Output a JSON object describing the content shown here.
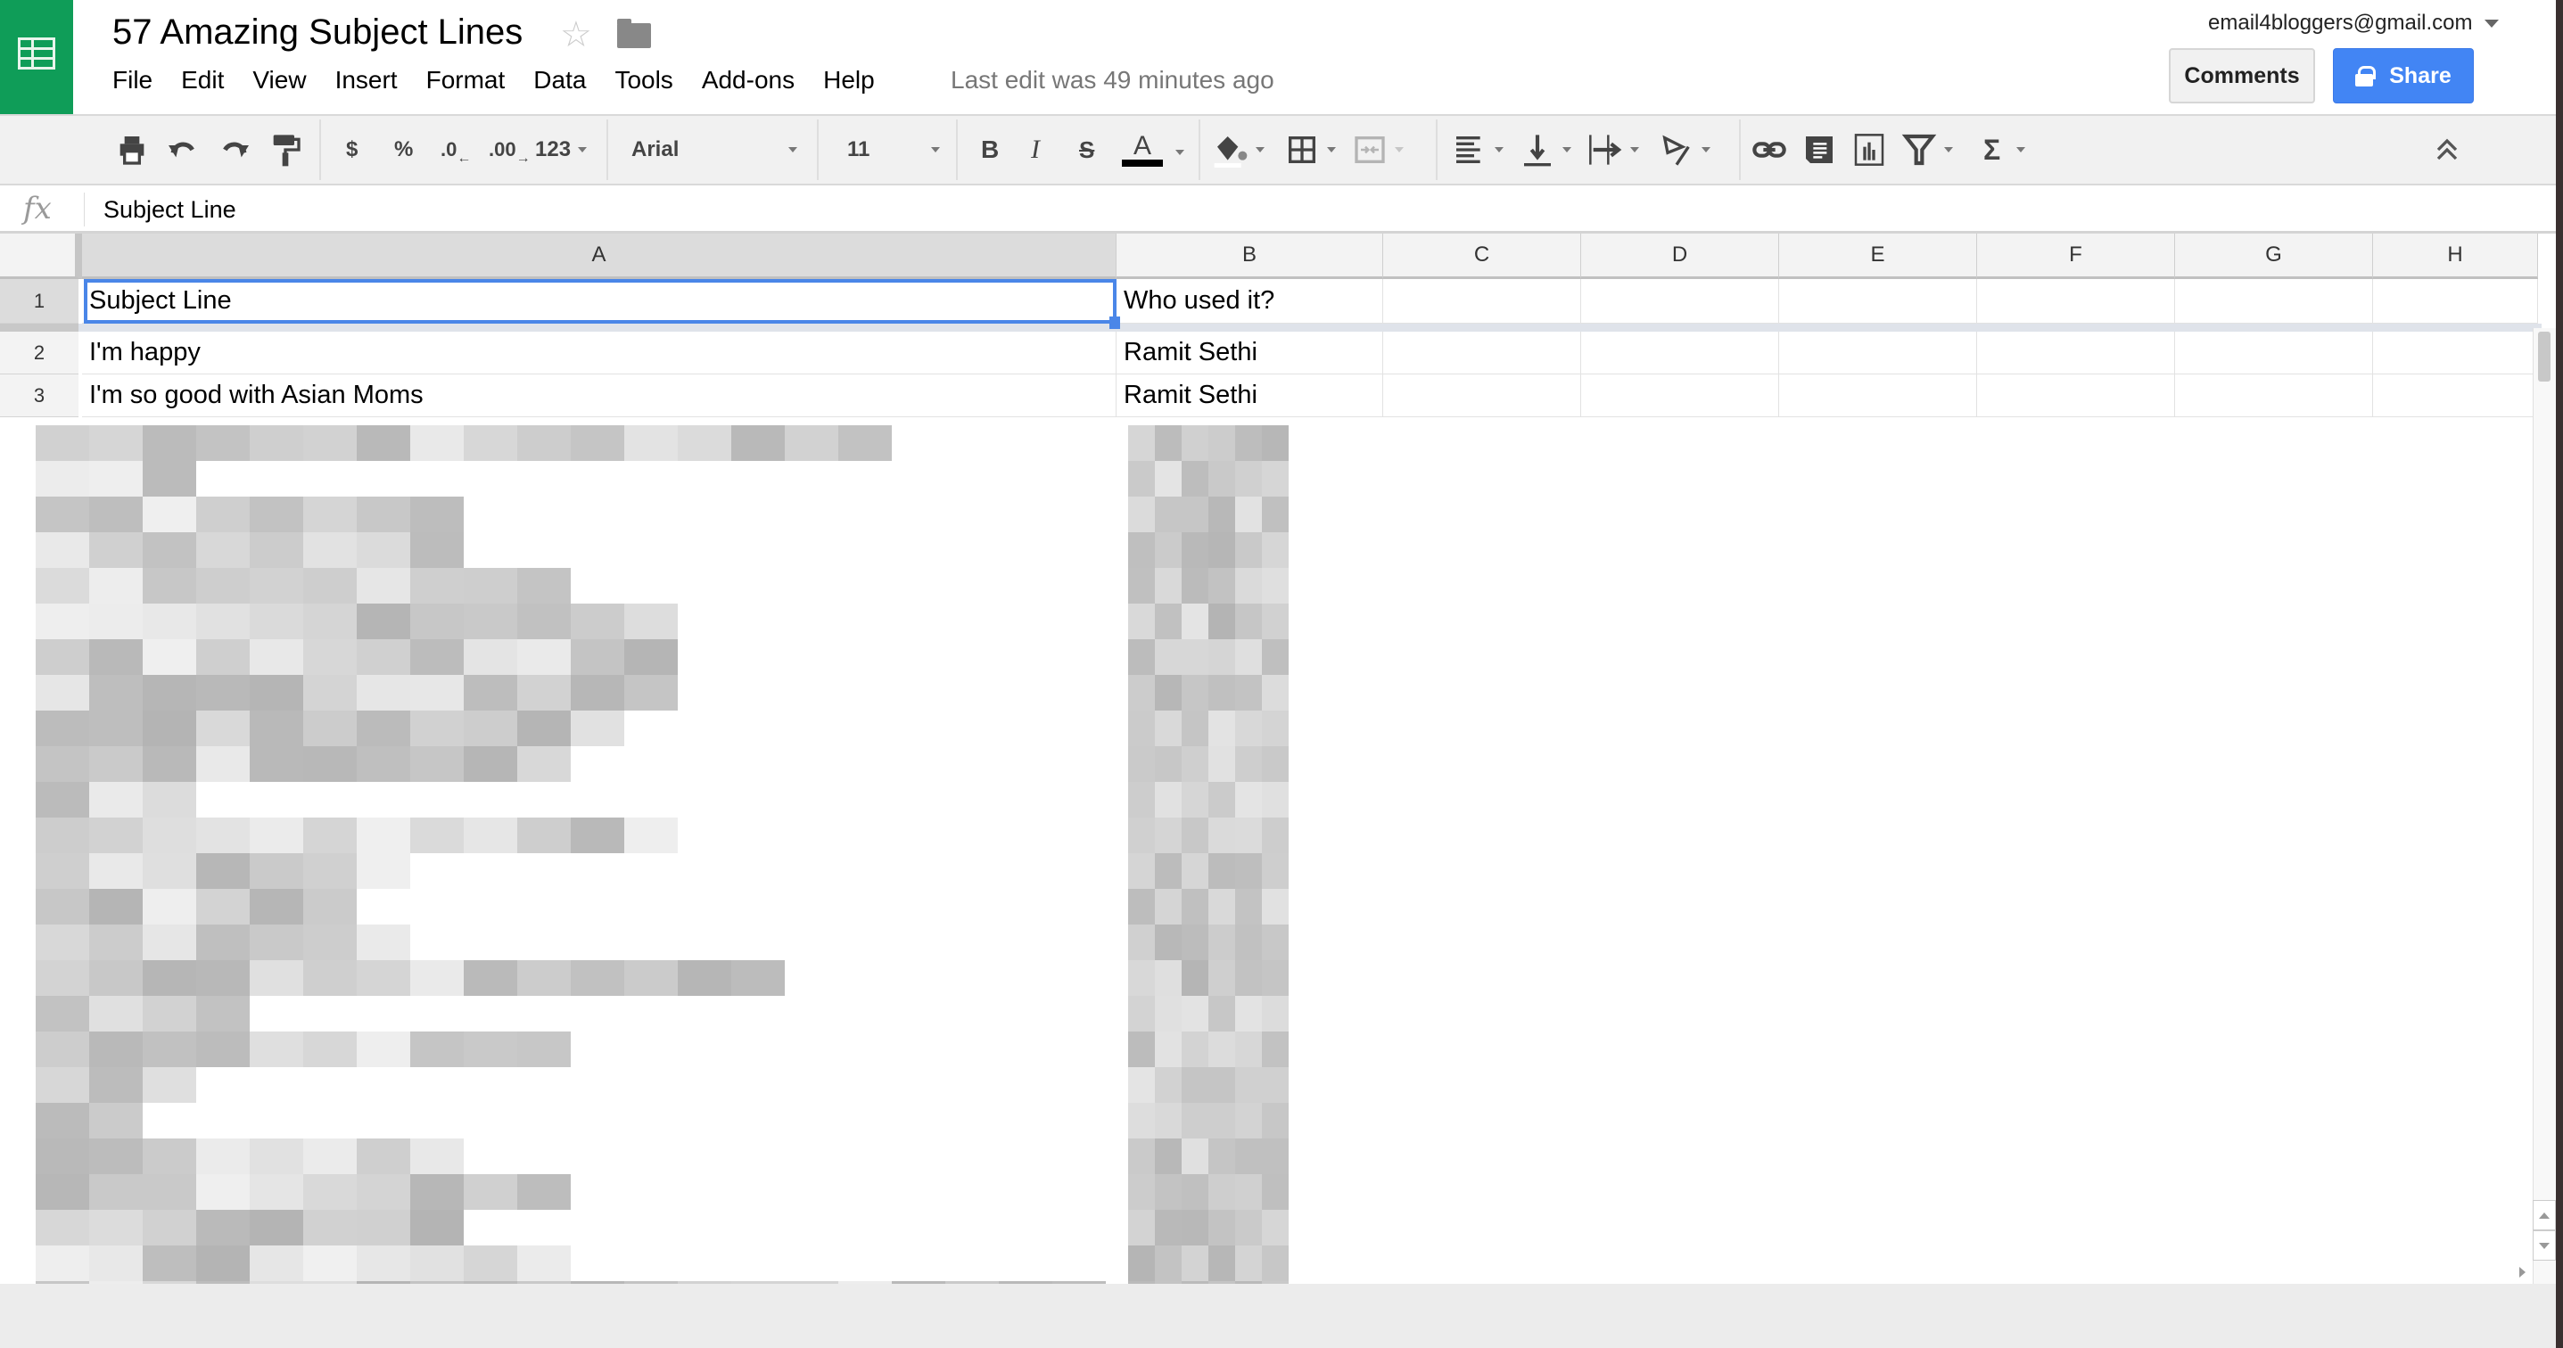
{
  "app": {
    "title": "57 Amazing Subject Lines",
    "logo_icon": "sheets-grid-icon",
    "star_icon": "☆",
    "folder_icon": "folder-icon"
  },
  "menu": {
    "items": [
      "File",
      "Edit",
      "View",
      "Insert",
      "Format",
      "Data",
      "Tools",
      "Add-ons",
      "Help"
    ],
    "last_edit": "Last edit was 49 minutes ago"
  },
  "account": {
    "email": "email4bloggers@gmail.com"
  },
  "buttons": {
    "comments": "Comments",
    "share": "Share"
  },
  "toolbar": {
    "currency": "$",
    "percent": "%",
    "decrease_decimal": ".0",
    "increase_decimal": ".00",
    "more_formats": "123",
    "font": "Arial",
    "font_size": "11",
    "bold": "B",
    "italic": "I",
    "strikethrough": "S",
    "text_color": "A",
    "sum": "Σ",
    "text_color_value": "#000000",
    "fill_color_value": "#ffffff"
  },
  "formula_bar": {
    "fx": "fx",
    "value": "Subject Line"
  },
  "grid": {
    "columns": [
      "A",
      "B",
      "C",
      "D",
      "E",
      "F",
      "G",
      "H"
    ],
    "selected_column": "A",
    "selected_cell": "A1",
    "rows": [
      {
        "num": "1",
        "cells": [
          "Subject Line",
          "Who used it?"
        ]
      },
      {
        "num": "2",
        "cells": [
          "I'm happy",
          "Ramit Sethi"
        ]
      },
      {
        "num": "3",
        "cells": [
          "I'm so good with Asian Moms",
          "Ramit Sethi"
        ]
      }
    ]
  },
  "colors": {
    "brand_green": "#0f9d58",
    "share_blue": "#4285f4",
    "selection_blue": "#4a86e8"
  }
}
